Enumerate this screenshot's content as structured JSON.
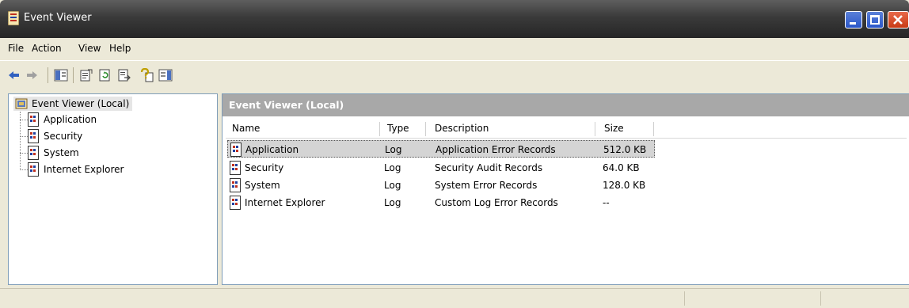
{
  "window": {
    "title": "Event Viewer",
    "accent": "#2a56c8",
    "close_color": "#c83a14"
  },
  "menu": {
    "items": [
      {
        "label": "File"
      },
      {
        "label": "Action"
      },
      {
        "label": "View"
      },
      {
        "label": "Help"
      }
    ]
  },
  "toolbar": {
    "icons": [
      "back-arrow-icon",
      "forward-arrow-icon",
      "show-hide-tree-icon",
      "properties-icon",
      "refresh-icon",
      "export-list-icon",
      "help-icon",
      "show-hide-action-pane-icon"
    ]
  },
  "tree": {
    "root_label": "Event Viewer (Local)",
    "items": [
      {
        "label": "Application"
      },
      {
        "label": "Security"
      },
      {
        "label": "System"
      },
      {
        "label": "Internet Explorer"
      }
    ]
  },
  "list": {
    "header": "Event Viewer (Local)",
    "columns": {
      "name": "Name",
      "type": "Type",
      "description": "Description",
      "size": "Size"
    },
    "rows": [
      {
        "name": "Application",
        "type": "Log",
        "description": "Application Error Records",
        "size": "512.0 KB",
        "selected": true
      },
      {
        "name": "Security",
        "type": "Log",
        "description": "Security Audit Records",
        "size": "64.0 KB"
      },
      {
        "name": "System",
        "type": "Log",
        "description": "System Error Records",
        "size": "128.0 KB"
      },
      {
        "name": "Internet Explorer",
        "type": "Log",
        "description": "Custom Log Error Records",
        "size": "--"
      }
    ]
  }
}
